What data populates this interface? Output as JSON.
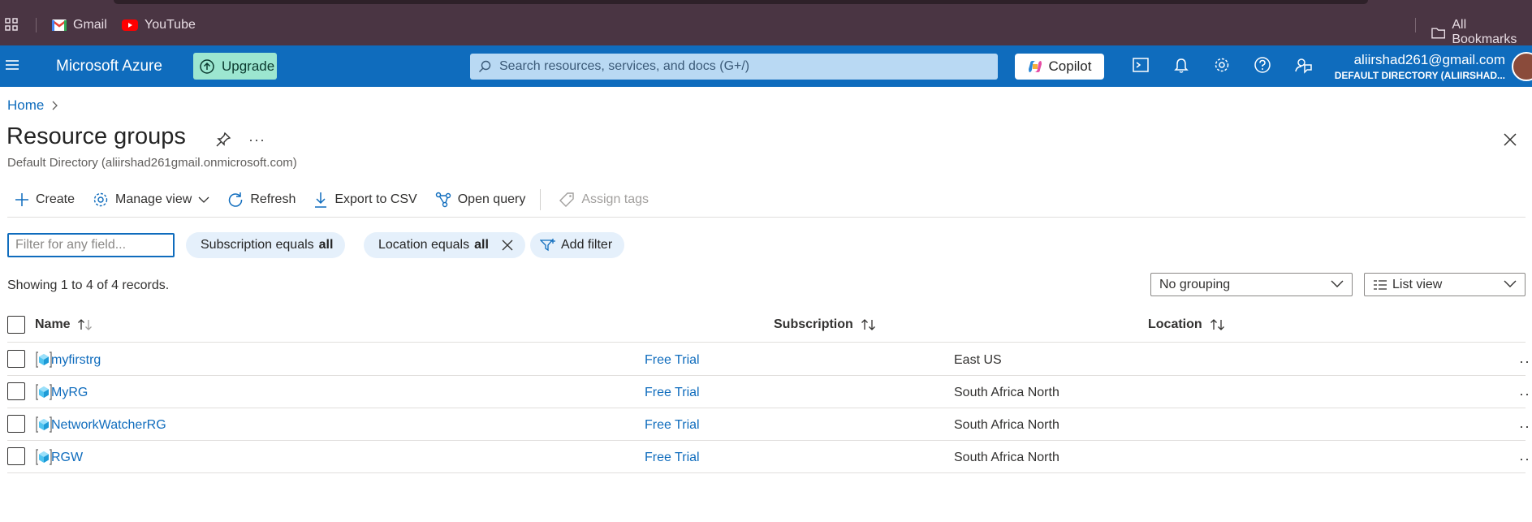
{
  "browser": {
    "bookmarks": [
      {
        "label": "Gmail",
        "icon": "gmail-icon"
      },
      {
        "label": "YouTube",
        "icon": "youtube-icon"
      }
    ],
    "all_bookmarks": "All Bookmarks"
  },
  "header": {
    "brand": "Microsoft Azure",
    "upgrade": "Upgrade",
    "search_placeholder": "Search resources, services, and docs (G+/)",
    "copilot": "Copilot",
    "account_email": "aliirshad261@gmail.com",
    "account_directory": "DEFAULT DIRECTORY (ALIIRSHAD...",
    "icons": [
      "cloud-shell-icon",
      "bell-icon",
      "gear-icon",
      "help-icon",
      "feedback-icon"
    ]
  },
  "breadcrumb": {
    "home": "Home"
  },
  "page": {
    "title": "Resource groups",
    "subtitle": "Default Directory (aliirshad261gmail.onmicrosoft.com)"
  },
  "toolbar": {
    "create": "Create",
    "manage_view": "Manage view",
    "refresh": "Refresh",
    "export": "Export to CSV",
    "open_query": "Open query",
    "assign_tags": "Assign tags"
  },
  "filters": {
    "placeholder": "Filter for any field...",
    "subscription_prefix": "Subscription equals",
    "subscription_value": "all",
    "location_prefix": "Location equals",
    "location_value": "all",
    "add_filter": "Add filter"
  },
  "records_text": "Showing 1 to 4 of 4 records.",
  "grouping": "No grouping",
  "view": "List view",
  "table": {
    "columns": {
      "name": "Name",
      "subscription": "Subscription",
      "location": "Location"
    },
    "rows": [
      {
        "name": "myfirstrg",
        "subscription": "Free Trial",
        "location": "East US"
      },
      {
        "name": "MyRG",
        "subscription": "Free Trial",
        "location": "South Africa North"
      },
      {
        "name": "NetworkWatcherRG",
        "subscription": "Free Trial",
        "location": "South Africa North"
      },
      {
        "name": "RGW",
        "subscription": "Free Trial",
        "location": "South Africa North"
      }
    ]
  },
  "colors": {
    "azure_blue": "#0f6cbd",
    "browser_bar": "#4a3543",
    "upgrade_bg": "#9ce6d0",
    "pill_bg": "#e5f0fb"
  }
}
